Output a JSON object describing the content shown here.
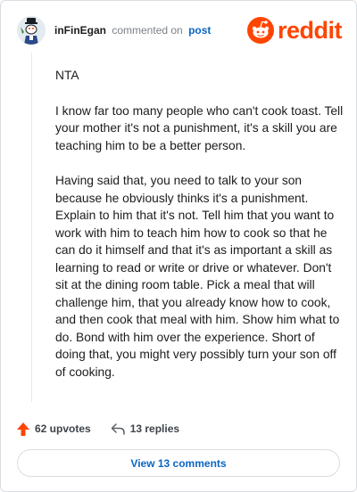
{
  "comment": {
    "username": "inFinEgan",
    "action_text": "commented on",
    "post_link": "post",
    "paragraphs": [
      "NTA",
      "I know far too many people who can't cook toast. Tell your mother it's not a punishment, it's a skill you are teaching him to be a better person.",
      "Having said that, you need to talk to your son because he obviously thinks it's a punishment. Explain to him that it's not. Tell him that you want to work with him to teach him how to cook so that he can do it himself and that it's as important a skill as learning to read or write or drive or whatever. Don't sit at the dining room table. Pick a meal that will challenge him, that you already know how to cook, and then cook that meal with him. Show him what to do. Bond with him over the experience. Short of doing that, you might very possibly turn your son off of cooking."
    ],
    "upvotes_label": "62 upvotes",
    "replies_label": "13 replies",
    "view_comments_label": "View 13 comments"
  },
  "brand": {
    "logo_text": "reddit",
    "accent_color": "#ff4500",
    "link_color": "#0a66c2"
  },
  "icons": [
    "avatar",
    "reddit-logo-icon",
    "upvote-arrow-icon",
    "reply-arrow-icon"
  ]
}
